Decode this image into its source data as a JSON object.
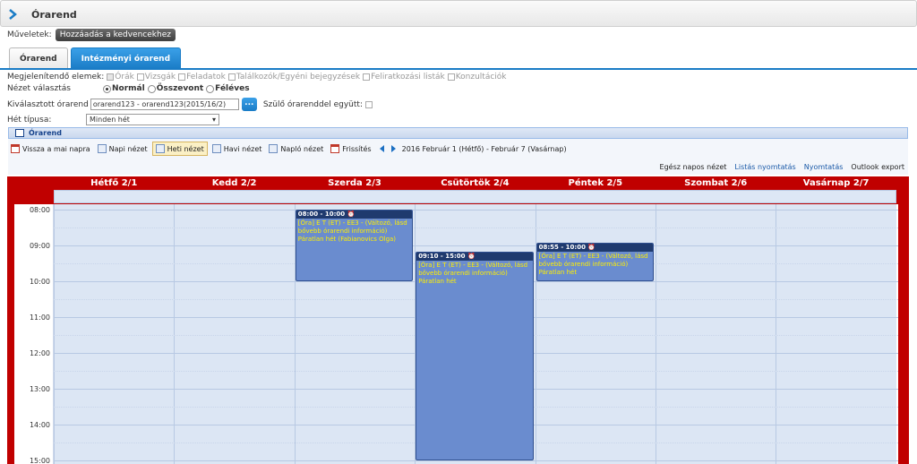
{
  "header": {
    "title": "Órarend"
  },
  "ops": {
    "label": "Műveletek:",
    "favorite_button": "Hozzáadás a kedvencekhez"
  },
  "tabs": [
    {
      "label": "Órarend",
      "active": false
    },
    {
      "label": "Intézményi órarend",
      "active": true
    }
  ],
  "filters": {
    "elements_label": "Megjelenítendő elemek:",
    "elements": [
      {
        "label": "Órák",
        "checked": true
      },
      {
        "label": "Vizsgák",
        "checked": false
      },
      {
        "label": "Feladatok",
        "checked": false
      },
      {
        "label": "Találkozók/Egyéni bejegyzések",
        "checked": false
      },
      {
        "label": "Feliratkozási listák",
        "checked": false
      },
      {
        "label": "Konzultációk",
        "checked": false
      }
    ],
    "view_type_label": "Nézet választás",
    "view_types": [
      {
        "label": "Normál",
        "selected": true
      },
      {
        "label": "Összevont",
        "selected": false
      },
      {
        "label": "Féléves",
        "selected": false
      }
    ],
    "selected_timetable_label": "Kiválasztott órarend",
    "selected_timetable_value": "orarend123 - orarend123(2015/16/2)",
    "picker_button": "...",
    "parent_label": "Szülő órarenddel együtt:",
    "week_type_label": "Hét típusa:",
    "week_type_value": "Minden hét"
  },
  "panel": {
    "title": "Órarend"
  },
  "toolbar": {
    "today": "Vissza a mai napra",
    "day_view": "Napi nézet",
    "week_view": "Heti nézet",
    "month_view": "Havi nézet",
    "log_view": "Napló nézet",
    "refresh": "Frissítés",
    "range": "2016 Február 1 (Hétfő) - Február 7 (Vasárnap)"
  },
  "toolbar2": {
    "full_day": "Egész napos nézet",
    "list_print": "Listás nyomtatás",
    "print": "Nyomtatás",
    "outlook": "Outlook export"
  },
  "calendar": {
    "days": [
      "Hétfő 2/1",
      "Kedd 2/2",
      "Szerda 2/3",
      "Csütörtök 2/4",
      "Péntek 2/5",
      "Szombat 2/6",
      "Vasárnap 2/7"
    ],
    "hours": [
      "08:00",
      "09:00",
      "10:00",
      "11:00",
      "12:00",
      "13:00",
      "14:00",
      "15:00"
    ],
    "events": [
      {
        "day": 2,
        "start": 8.0,
        "end": 10.0,
        "time": "08:00 - 10:00",
        "text": "[Óra] E T (ET) - EE3 - (Változó, lásd bővebb órarendi információ) Páratlan hét (Fabianovics Olga)"
      },
      {
        "day": 3,
        "start": 9.1667,
        "end": 15.0,
        "time": "09:10 - 15:00",
        "text": "[Óra] E T (ET) - EE3 - (Változó, lásd bővebb órarendi információ) Páratlan hét"
      },
      {
        "day": 4,
        "start": 8.9167,
        "end": 10.0,
        "time": "08:55 - 10:00",
        "text": "[Óra] E T (ET) - EE3 - (Változó, lásd bővebb órarendi információ) Páratlan hét"
      }
    ]
  }
}
